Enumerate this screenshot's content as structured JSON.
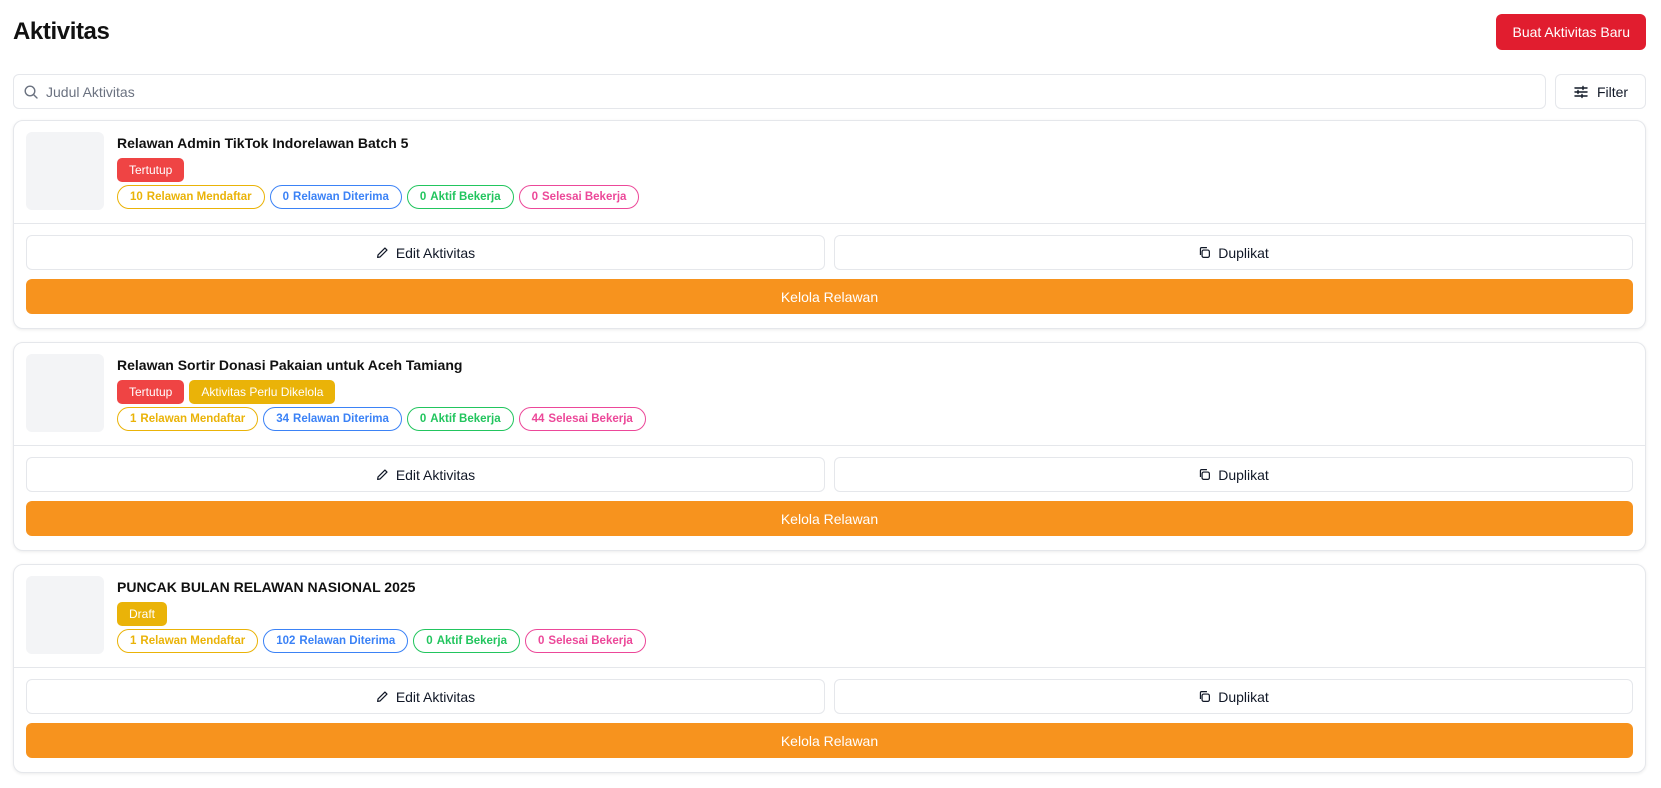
{
  "header": {
    "title": "Aktivitas",
    "new_button_label": "Buat Aktivitas Baru"
  },
  "search": {
    "placeholder": "Judul Aktivitas",
    "value": "",
    "filter_label": "Filter"
  },
  "colors": {
    "primary_red": "#e11d2f",
    "orange": "#f7931e",
    "status_red": "#ef4444",
    "status_yellow": "#eab308",
    "pill_yellow": "#eab308",
    "pill_blue": "#3b82f6",
    "pill_green": "#22c55e",
    "pill_pink": "#ec4899"
  },
  "icons": {
    "search": "search-icon",
    "filter": "sliders-icon",
    "edit": "pencil-icon",
    "duplicate": "copy-icon"
  },
  "activities": [
    {
      "title": "Relawan Admin TikTok Indorelawan Batch 5",
      "statuses": [
        {
          "label": "Tertutup",
          "color": "red"
        }
      ],
      "stats": {
        "registered": {
          "count": "10",
          "label": "Relawan Mendaftar"
        },
        "accepted": {
          "count": "0",
          "label": "Relawan Diterima"
        },
        "active": {
          "count": "0",
          "label": "Aktif Bekerja"
        },
        "done": {
          "count": "0",
          "label": "Selesai Bekerja"
        }
      },
      "edit_label": "Edit Aktivitas",
      "duplicate_label": "Duplikat",
      "manage_label": "Kelola Relawan"
    },
    {
      "title": "Relawan Sortir Donasi Pakaian untuk Aceh Tamiang",
      "statuses": [
        {
          "label": "Tertutup",
          "color": "red"
        },
        {
          "label": "Aktivitas Perlu Dikelola",
          "color": "yellow"
        }
      ],
      "stats": {
        "registered": {
          "count": "1",
          "label": "Relawan Mendaftar"
        },
        "accepted": {
          "count": "34",
          "label": "Relawan Diterima"
        },
        "active": {
          "count": "0",
          "label": "Aktif Bekerja"
        },
        "done": {
          "count": "44",
          "label": "Selesai Bekerja"
        }
      },
      "edit_label": "Edit Aktivitas",
      "duplicate_label": "Duplikat",
      "manage_label": "Kelola Relawan"
    },
    {
      "title": "PUNCAK BULAN RELAWAN NASIONAL 2025",
      "statuses": [
        {
          "label": "Draft",
          "color": "yellow"
        }
      ],
      "stats": {
        "registered": {
          "count": "1",
          "label": "Relawan Mendaftar"
        },
        "accepted": {
          "count": "102",
          "label": "Relawan Diterima"
        },
        "active": {
          "count": "0",
          "label": "Aktif Bekerja"
        },
        "done": {
          "count": "0",
          "label": "Selesai Bekerja"
        }
      },
      "edit_label": "Edit Aktivitas",
      "duplicate_label": "Duplikat",
      "manage_label": "Kelola Relawan"
    }
  ]
}
